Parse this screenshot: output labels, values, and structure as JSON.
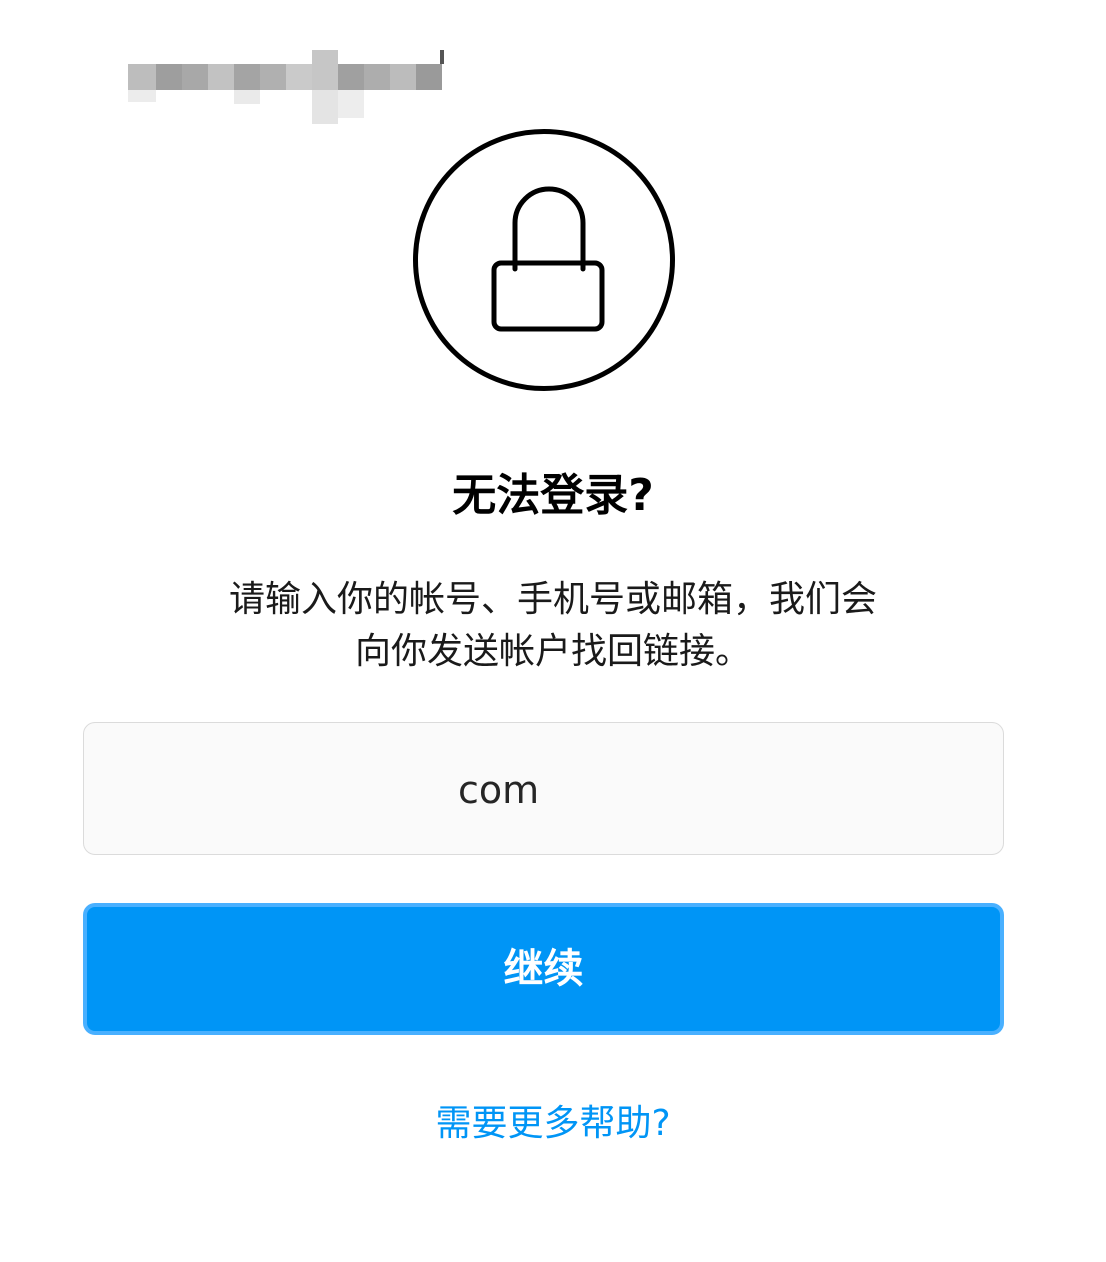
{
  "header": {
    "icon": "lock-icon",
    "title": "无法登录?"
  },
  "description": {
    "line1": "请输入你的帐号、手机号或邮箱，我们会",
    "line2": "向你发送帐户找回链接。"
  },
  "account_input": {
    "value_suffix": "com",
    "value_obscured": true
  },
  "continue_button": {
    "label": "继续"
  },
  "help_link": {
    "label": "需要更多帮助?"
  },
  "colors": {
    "primary": "#0095f6",
    "button_border": "#49b0ff",
    "input_background": "#fafafa",
    "input_border": "#dbdbdb",
    "text": "#000000"
  }
}
